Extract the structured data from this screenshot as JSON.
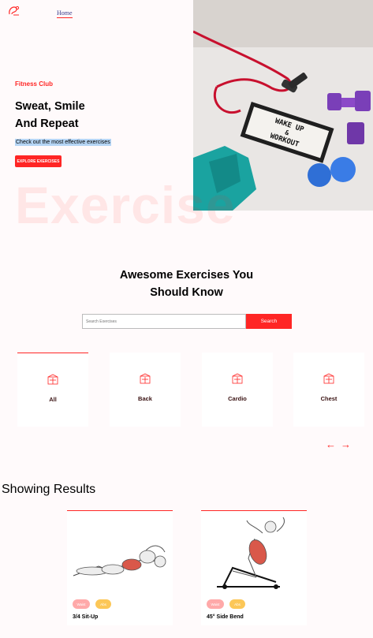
{
  "nav": {
    "home_label": "Home"
  },
  "hero": {
    "tag": "Fitness Club",
    "title_line1": "Sweat, Smile",
    "title_line2": "And Repeat",
    "subtitle": "Check out the most effective exercises",
    "button_label": "EXPLORE EXERCISES",
    "watermark": "Exercise",
    "photo_text_line1": "WAKE UP",
    "photo_text_line2": "&",
    "photo_text_line3": "WORKOUT"
  },
  "search": {
    "title_line1": "Awesome Exercises You",
    "title_line2": "Should Know",
    "placeholder": "Search Exercises",
    "button_label": "Search"
  },
  "categories": [
    {
      "label": "All",
      "icon": "gym-icon",
      "active": true
    },
    {
      "label": "Back",
      "icon": "gym-icon",
      "active": false
    },
    {
      "label": "Cardio",
      "icon": "gym-icon",
      "active": false
    },
    {
      "label": "Chest",
      "icon": "gym-icon",
      "active": false
    }
  ],
  "carousel": {
    "prev_icon": "arrow-left-icon",
    "next_icon": "arrow-right-icon"
  },
  "results": {
    "title": "Showing Results",
    "cards": [
      {
        "name": "3/4 Sit-Up",
        "body_part": "Waist",
        "target": "Abs"
      },
      {
        "name": "45° Side Bend",
        "body_part": "Waist",
        "target": "Abs"
      }
    ]
  },
  "colors": {
    "accent": "#ff2625",
    "pill_body": "#ffa9a9",
    "pill_target": "#fcc757"
  }
}
